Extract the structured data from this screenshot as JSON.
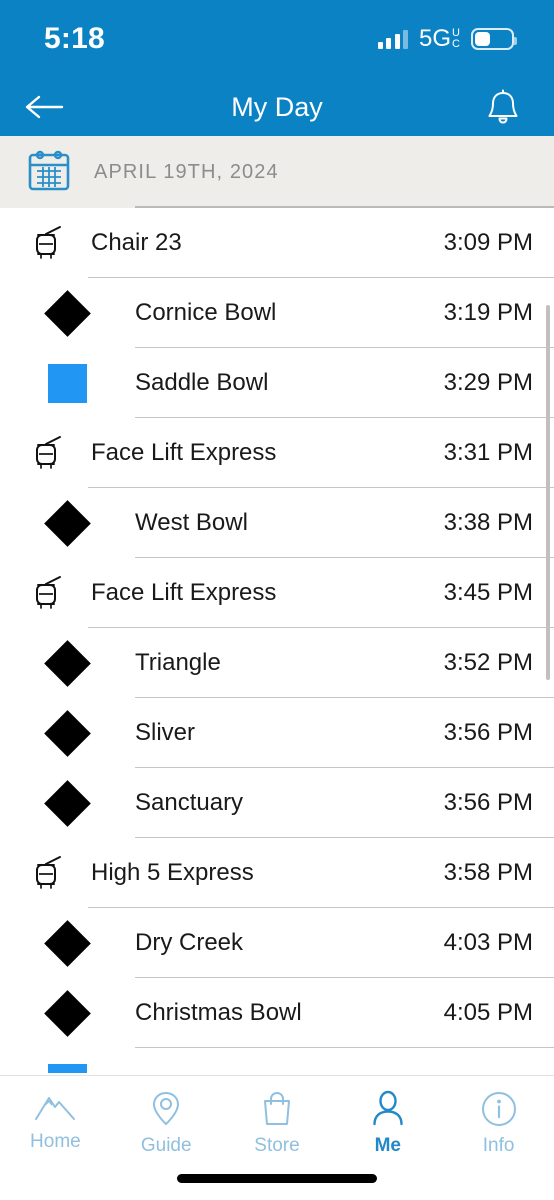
{
  "status_bar": {
    "time": "5:18",
    "network": "5G",
    "network_sub_top": "U",
    "network_sub_bottom": "C",
    "signal_icon": "signal-bars-icon",
    "battery_icon": "battery-icon"
  },
  "nav": {
    "title": "My Day",
    "back_icon": "back-arrow-icon",
    "bell_icon": "bell-icon"
  },
  "date_header": {
    "label": "APRIL 19TH, 2024",
    "calendar_icon": "calendar-icon"
  },
  "colors": {
    "header_blue": "#0b82c4",
    "tab_active": "#2288c8",
    "tab_inactive": "#8fc0e0",
    "blue_square": "#2196f3",
    "black_diamond": "#000000",
    "date_bar_bg": "#eeedea"
  },
  "activities": [
    {
      "type": "lift",
      "icon": "gondola-icon",
      "name": "Chair 23",
      "time": "3:09 PM"
    },
    {
      "type": "run",
      "icon": "black-diamond",
      "name": "Cornice Bowl",
      "time": "3:19 PM"
    },
    {
      "type": "run",
      "icon": "blue-square",
      "name": "Saddle Bowl",
      "time": "3:29 PM"
    },
    {
      "type": "lift",
      "icon": "gondola-icon",
      "name": "Face Lift Express",
      "time": "3:31 PM"
    },
    {
      "type": "run",
      "icon": "black-diamond",
      "name": "West Bowl",
      "time": "3:38 PM"
    },
    {
      "type": "lift",
      "icon": "gondola-icon",
      "name": "Face Lift Express",
      "time": "3:45 PM"
    },
    {
      "type": "run",
      "icon": "black-diamond",
      "name": "Triangle",
      "time": "3:52 PM"
    },
    {
      "type": "run",
      "icon": "black-diamond",
      "name": "Sliver",
      "time": "3:56 PM"
    },
    {
      "type": "run",
      "icon": "black-diamond",
      "name": "Sanctuary",
      "time": "3:56 PM"
    },
    {
      "type": "lift",
      "icon": "gondola-icon",
      "name": "High 5 Express",
      "time": "3:58 PM"
    },
    {
      "type": "run",
      "icon": "black-diamond",
      "name": "Dry Creek",
      "time": "4:03 PM"
    },
    {
      "type": "run",
      "icon": "black-diamond",
      "name": "Christmas Bowl",
      "time": "4:05 PM"
    },
    {
      "type": "run",
      "icon": "blue-square",
      "name": "",
      "time": ""
    }
  ],
  "tabs": [
    {
      "label": "Home",
      "icon": "mountain-icon",
      "active": false
    },
    {
      "label": "Guide",
      "icon": "map-pin-icon",
      "active": false
    },
    {
      "label": "Store",
      "icon": "shopping-bag-icon",
      "active": false
    },
    {
      "label": "Me",
      "icon": "person-icon",
      "active": true
    },
    {
      "label": "Info",
      "icon": "info-circle-icon",
      "active": false
    }
  ]
}
